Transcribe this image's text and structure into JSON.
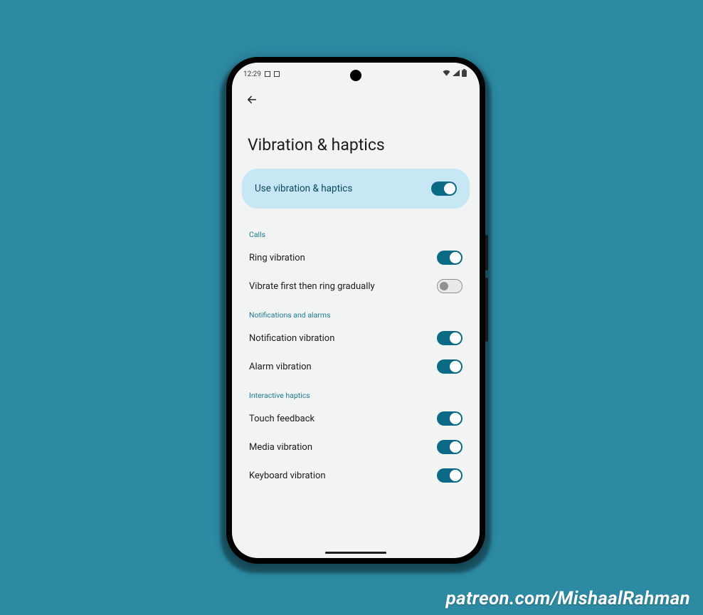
{
  "status": {
    "time": "12:29",
    "icons_left": [
      "ringer-icon",
      "card-icon"
    ],
    "icons_right": [
      "wifi-icon",
      "signal-icon",
      "battery-icon"
    ]
  },
  "page": {
    "title": "Vibration & haptics"
  },
  "master": {
    "label": "Use vibration & haptics",
    "on": true
  },
  "sections": [
    {
      "header": "Calls",
      "items": [
        {
          "key": "ring-vibration",
          "label": "Ring vibration",
          "on": true
        },
        {
          "key": "vibrate-first",
          "label": "Vibrate first then ring gradually",
          "on": false
        }
      ]
    },
    {
      "header": "Notifications and alarms",
      "items": [
        {
          "key": "notification-vibration",
          "label": "Notification vibration",
          "on": true
        },
        {
          "key": "alarm-vibration",
          "label": "Alarm vibration",
          "on": true
        }
      ]
    },
    {
      "header": "Interactive haptics",
      "items": [
        {
          "key": "touch-feedback",
          "label": "Touch feedback",
          "on": true
        },
        {
          "key": "media-vibration",
          "label": "Media vibration",
          "on": true
        },
        {
          "key": "keyboard-vibration",
          "label": "Keyboard vibration",
          "on": true
        }
      ]
    }
  ],
  "watermark": "patreon.com/MishaalRahman",
  "colors": {
    "background": "#2c8aa3",
    "screen": "#f2f4f4",
    "accent": "#0b6a84",
    "card": "#c7e7f4",
    "category": "#1b7a8f"
  }
}
